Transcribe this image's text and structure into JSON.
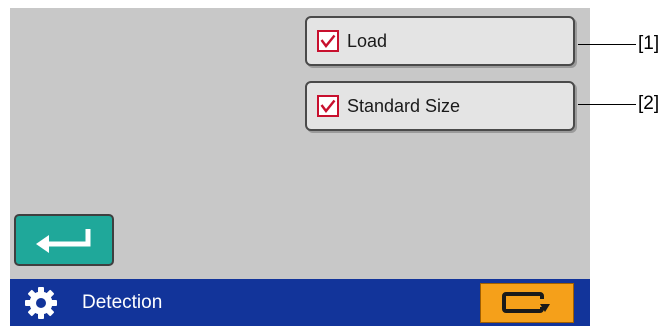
{
  "options": [
    {
      "label": "Load",
      "checked": true
    },
    {
      "label": "Standard Size",
      "checked": true
    }
  ],
  "status_bar": {
    "title": "Detection",
    "icon": "gear-icon"
  },
  "buttons": {
    "enter_icon": "enter-return-icon",
    "swap_icon": "tray-swap-icon"
  },
  "callouts": [
    "[1]",
    "[2]"
  ],
  "colors": {
    "screen_bg": "#c8c8c8",
    "option_bg": "#e4e4e4",
    "check_mark": "#c8102e",
    "enter_button": "#1fa89a",
    "status_bar": "#12349a",
    "swap_button": "#f5a01a"
  }
}
